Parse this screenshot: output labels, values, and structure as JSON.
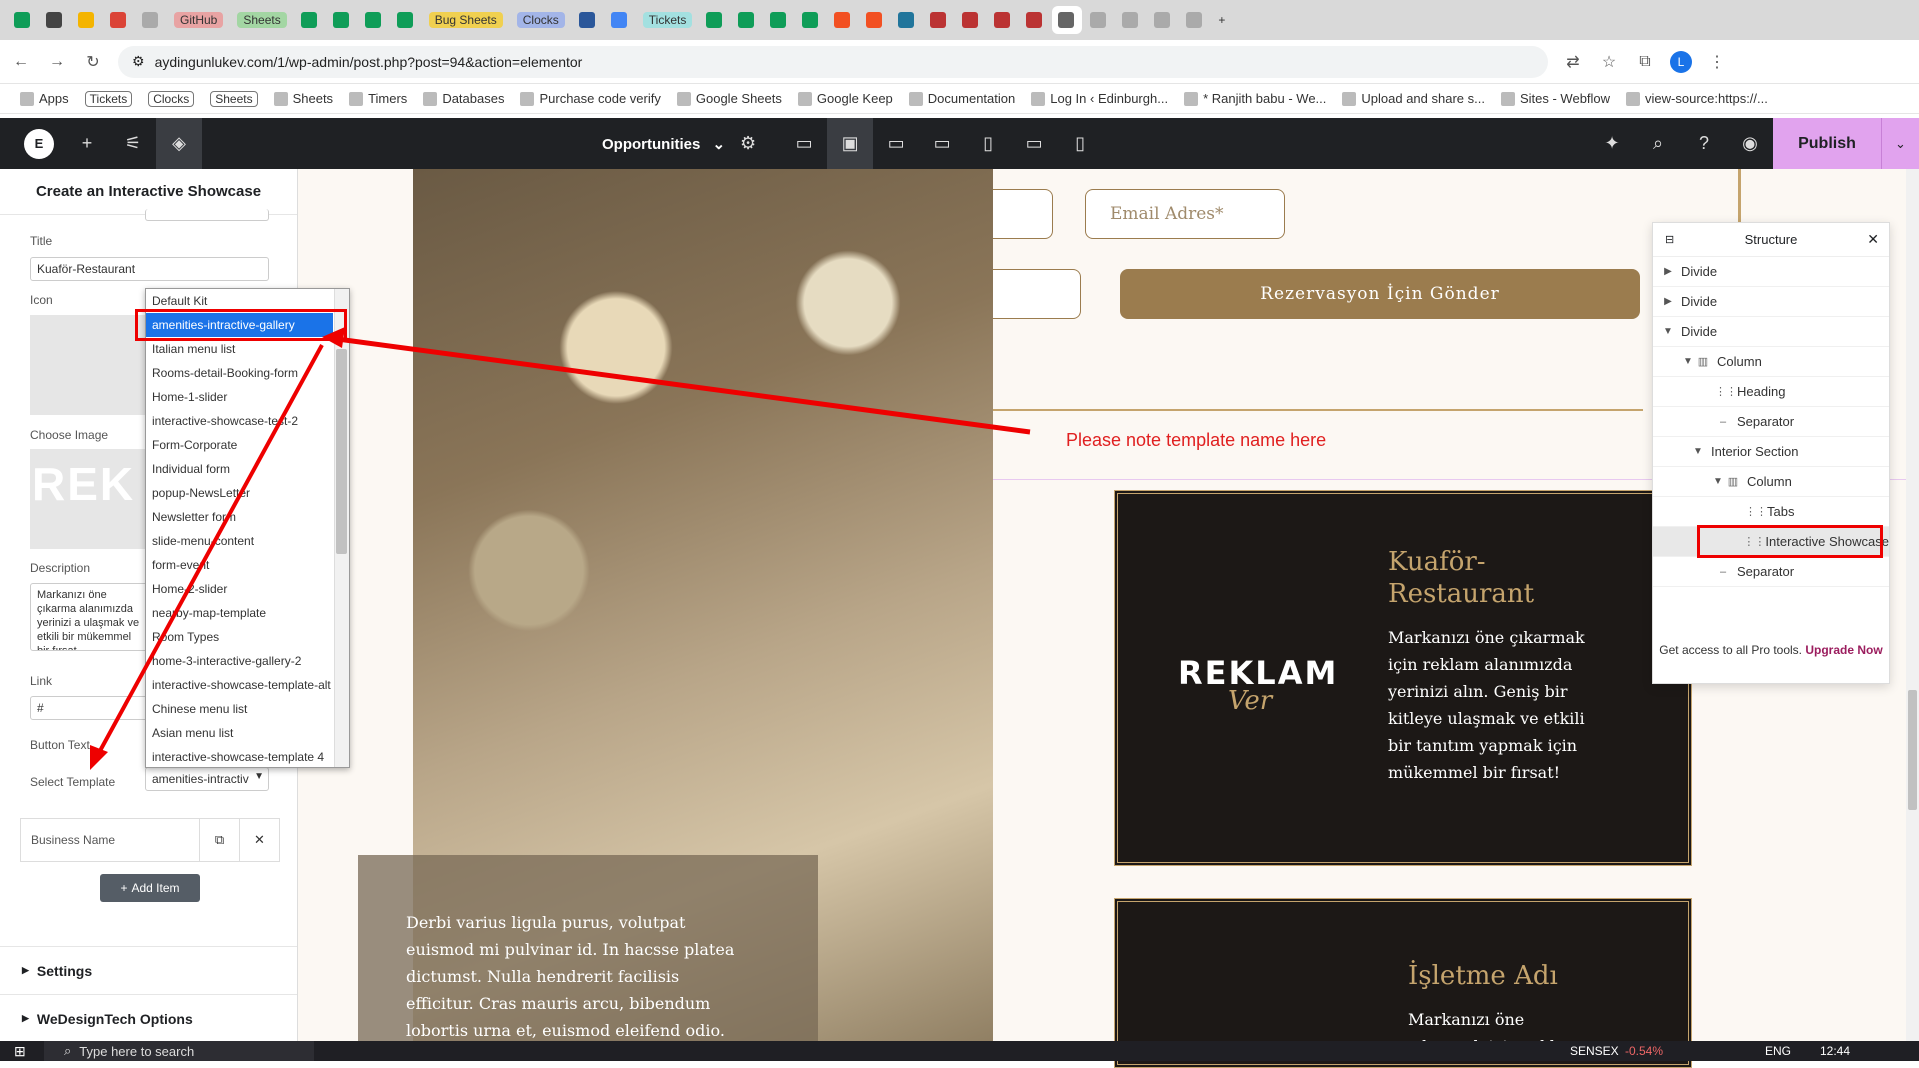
{
  "browser": {
    "tabs": [
      {
        "color": "#0f9d58"
      },
      {
        "color": "#444"
      },
      {
        "color": "#f4b400"
      },
      {
        "color": "#db4437"
      },
      {
        "color": "#aaa"
      },
      {
        "label": "GitHub",
        "label_bg": "#e8a3a3"
      },
      {
        "label": "Sheets",
        "label_bg": "#a3d6a3"
      },
      {
        "color": "#0f9d58"
      },
      {
        "color": "#0f9d58"
      },
      {
        "color": "#0f9d58"
      },
      {
        "color": "#0f9d58"
      },
      {
        "label": "Bug Sheets",
        "label_bg": "#f0d050"
      },
      {
        "label": "Clocks",
        "label_bg": "#a3b5e8"
      },
      {
        "color": "#2b579a"
      },
      {
        "color": "#4285f4"
      },
      {
        "label": "Tickets",
        "label_bg": "#a3e0e0"
      },
      {
        "color": "#0f9d58"
      },
      {
        "color": "#0f9d58"
      },
      {
        "color": "#0f9d58"
      },
      {
        "color": "#0f9d58"
      },
      {
        "color": "#f25022"
      },
      {
        "color": "#f25022"
      },
      {
        "color": "#21759b"
      },
      {
        "color": "#b33"
      },
      {
        "color": "#b33"
      },
      {
        "color": "#b33"
      },
      {
        "color": "#b33"
      },
      {
        "color": "#666",
        "active": true
      },
      {
        "color": "#aaa"
      },
      {
        "color": "#aaa"
      },
      {
        "color": "#aaa"
      },
      {
        "color": "#aaa"
      }
    ],
    "url": "aydingunlukev.com/1/wp-admin/post.php?post=94&action=elementor",
    "bookmarks": [
      {
        "label": "Apps"
      },
      {
        "label": "Tickets",
        "pill": true
      },
      {
        "label": "Clocks",
        "pill": true
      },
      {
        "label": "Sheets",
        "pill": true
      },
      {
        "label": "Sheets"
      },
      {
        "label": "Timers"
      },
      {
        "label": "Databases"
      },
      {
        "label": "Purchase code verify"
      },
      {
        "label": "Google Sheets"
      },
      {
        "label": "Google Keep"
      },
      {
        "label": "Documentation"
      },
      {
        "label": "Log In ‹ Edinburgh..."
      },
      {
        "label": "* Ranjith babu - We..."
      },
      {
        "label": "Upload and share s..."
      },
      {
        "label": "Sites - Webflow"
      },
      {
        "label": "view-source:https://..."
      }
    ]
  },
  "editor": {
    "page_name": "Opportunities",
    "publish_label": "Publish"
  },
  "left_panel": {
    "title": "Create an Interactive Showcase",
    "title_field_label": "Title",
    "title_field_value": "Kuaför-Restaurant",
    "icon_label": "Icon",
    "choose_image_label": "Choose Image",
    "image_text": "REK",
    "description_label": "Description",
    "description_value": "Markanızı öne çıkarma alanımızda yerinizi a ulaşmak ve etkili bir mükemmel bir fırsat",
    "link_label": "Link",
    "link_value": "#",
    "button_text_label": "Button Text",
    "select_template_label": "Select Template",
    "select_template_value": "amenities-intractiv",
    "business_name": "Business Name",
    "add_item": "Add Item",
    "settings": "Settings",
    "wedesign": "WeDesignTech Options"
  },
  "dropdown": {
    "options": [
      "Default Kit",
      "amenities-intractive-gallery",
      "Italian menu list",
      "Rooms-detail-Booking-form",
      "Home-1-slider",
      "interactive-showcase-test-2",
      "Form-Corporate",
      "Individual form",
      "popup-NewsLetter",
      "Newsletter form",
      "slide-menu-content",
      "form-event",
      "Home-2-slider",
      "nearby-map-template",
      "Room Types",
      "home-3-interactive-gallery-2",
      "interactive-showcase-template-alt",
      "Chinese menu list",
      "Asian menu list",
      "interactive-showcase-template 4"
    ],
    "selected_index": 1
  },
  "canvas": {
    "email_placeholder": "Email Adres*",
    "send_button": "Rezervasyon İçin Gönder",
    "note": "Please note template name here",
    "photo_caption": "Derbi varius ligula purus, volutpat euismod mi pulvinar id. In hacsse platea dictumst. Nulla hendrerit facilisis efficitur. Cras mauris arcu, bibendum lobortis urna et, euismod eleifend odio.",
    "card1_title": "Kuaför-Restaurant",
    "card1_desc": "Markanızı öne çıkarmak için reklam alanımızda yerinizi alın. Geniş bir kitleye ulaşmak ve etkili bir tanıtım yapmak için mükemmel bir fırsat!",
    "reklam_text": "REKLAM",
    "reklam_script": "Ver",
    "card2_title": "İşletme Adı",
    "card2_desc": "Markanızı öne çıkarmak için reklam"
  },
  "structure": {
    "title": "Structure",
    "items": [
      {
        "label": "Divide",
        "level": 0,
        "caret": "▶",
        "icon": ""
      },
      {
        "label": "Divide",
        "level": 0,
        "caret": "▶",
        "icon": ""
      },
      {
        "label": "Divide",
        "level": 0,
        "caret": "▼",
        "icon": ""
      },
      {
        "label": "Column",
        "level": 1,
        "caret": "▼",
        "icon": "▥"
      },
      {
        "label": "Heading",
        "level": 2,
        "caret": "",
        "icon": "⋮⋮"
      },
      {
        "label": "Separator",
        "level": 2,
        "caret": "",
        "icon": "‒"
      },
      {
        "label": "Interior Section",
        "level": 1.5,
        "caret": "▼",
        "icon": ""
      },
      {
        "label": "Column",
        "level": 2.5,
        "caret": "▼",
        "icon": "▥"
      },
      {
        "label": "Tabs",
        "level": 3.5,
        "caret": "",
        "icon": "⋮⋮"
      },
      {
        "label": "Interactive Showcase",
        "level": 3.5,
        "caret": "",
        "icon": "⋮⋮",
        "selected": true
      },
      {
        "label": "Separator",
        "level": 2,
        "caret": "",
        "icon": "‒"
      }
    ],
    "promo": "Get access to all Pro tools.",
    "promo_link": "Upgrade Now"
  },
  "taskbar": {
    "search_placeholder": "Type here to search",
    "ticker": "SENSEX",
    "ticker_change": "-0.54%",
    "lang": "ENG",
    "time": "12:44"
  }
}
